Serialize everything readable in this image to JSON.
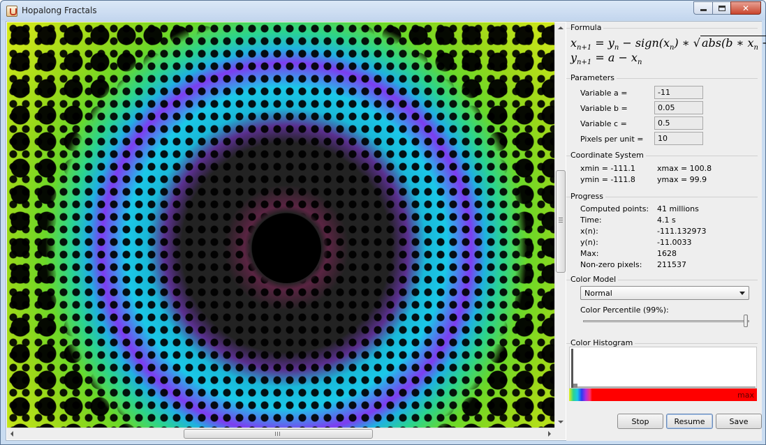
{
  "window": {
    "title": "Hopalong Fractals"
  },
  "formula": {
    "title": "Formula",
    "line1_lhs": "x",
    "line1_lhs_sub": "n+1",
    "line1_eq": " = ",
    "line1_y": "y",
    "line1_y_sub": "n",
    "line1_mid": " − sign(x",
    "line1_mid_sub": "n",
    "line1_mid_end": ") ∗ √",
    "line1_root": "abs(b ∗ x",
    "line1_root_sub": "n",
    "line1_root_end": " − c)",
    "line2_lhs": "y",
    "line2_lhs_sub": "n+1",
    "line2_rhs": " = a − x",
    "line2_rhs_sub": "n"
  },
  "parameters": {
    "title": "Parameters",
    "a_label": "Variable a =",
    "a_value": "-11",
    "b_label": "Variable b =",
    "b_value": "0.05",
    "c_label": "Variable c =",
    "c_value": "0.5",
    "ppu_label": "Pixels per unit =",
    "ppu_value": "10"
  },
  "coords": {
    "title": "Coordinate System",
    "xmin": "xmin = -111.1",
    "xmax": "xmax = 100.8",
    "ymin": "ymin = -111.8",
    "ymax": "ymax = 99.9"
  },
  "progress": {
    "title": "Progress",
    "rows": [
      {
        "label": "Computed points:",
        "value": "41 millions"
      },
      {
        "label": "Time:",
        "value": "4.1 s"
      },
      {
        "label": "x(n):",
        "value": "-111.132973"
      },
      {
        "label": "y(n):",
        "value": "-11.0033"
      },
      {
        "label": "Max:",
        "value": "1628"
      },
      {
        "label": "Non-zero pixels:",
        "value": "211537"
      }
    ]
  },
  "color_model": {
    "title": "Color Model",
    "selected": "Normal",
    "percentile_label": "Color Percentile (99%):",
    "percentile_value": 0.99
  },
  "histogram": {
    "title": "Color Histogram",
    "max_label": "max"
  },
  "buttons": {
    "stop": "Stop",
    "resume": "Resume",
    "save": "Save"
  },
  "scrollbars": {
    "horizontal_grip": "|||",
    "vertical_grip": "≡"
  },
  "colors": {
    "accent": "#1ac8e8",
    "histogram_max": "#ff0000",
    "fractal_outer": "#e8f01a"
  }
}
